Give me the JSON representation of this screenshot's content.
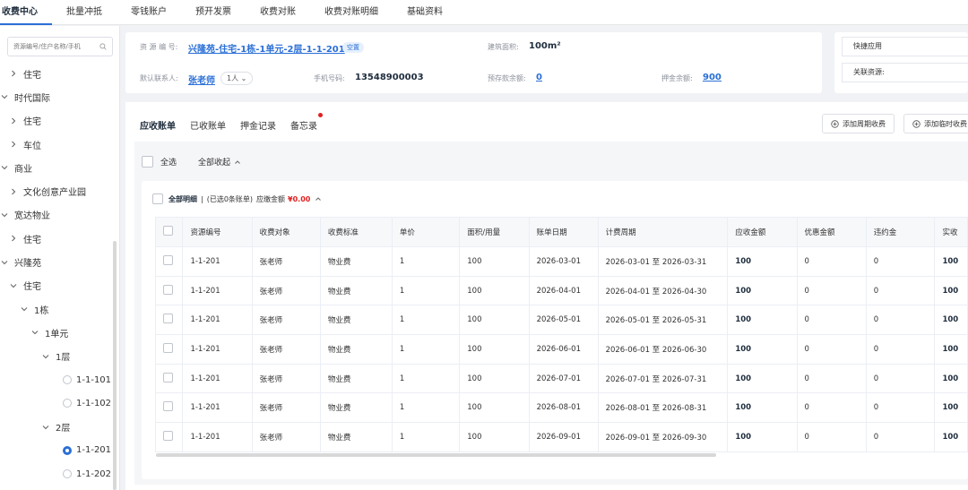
{
  "topnav": {
    "tabs": [
      "收费中心",
      "批量冲抵",
      "零钱账户",
      "预开发票",
      "收费对账",
      "收费对账明细",
      "基础资料"
    ]
  },
  "sidebar": {
    "search_placeholder": "资源编号/住户名称/手机",
    "tree": [
      {
        "label": "住宅",
        "level": 1,
        "icon": "chevron-right"
      },
      {
        "label": "时代国际",
        "level": 0,
        "icon": "chevron-down"
      },
      {
        "label": "住宅",
        "level": 1,
        "icon": "chevron-right"
      },
      {
        "label": "车位",
        "level": 1,
        "icon": "chevron-right"
      },
      {
        "label": "商业",
        "level": 0,
        "icon": "chevron-down"
      },
      {
        "label": "文化创意产业园",
        "level": 1,
        "icon": "chevron-right"
      },
      {
        "label": "宽达物业",
        "level": 0,
        "icon": "chevron-down"
      },
      {
        "label": "住宅",
        "level": 1,
        "icon": "chevron-right"
      },
      {
        "label": "兴隆苑",
        "level": 0,
        "icon": "chevron-down"
      },
      {
        "label": "住宅",
        "level": 1,
        "icon": "chevron-down"
      },
      {
        "label": "1栋",
        "level": 2,
        "icon": "chevron-down"
      },
      {
        "label": "1单元",
        "level": 3,
        "icon": "chevron-down"
      },
      {
        "label": "1层",
        "level": 4,
        "icon": "chevron-down"
      },
      {
        "label": "1-1-101",
        "level": 5,
        "icon": "radio"
      },
      {
        "label": "1-1-102",
        "level": 5,
        "icon": "radio"
      },
      {
        "label": "2层",
        "level": 4,
        "icon": "chevron-down"
      },
      {
        "label": "1-1-201",
        "level": 5,
        "icon": "radio-checked"
      },
      {
        "label": "1-1-202",
        "level": 5,
        "icon": "radio"
      }
    ]
  },
  "info": {
    "resource_label": "资 源 编 号:",
    "resource_value": "兴隆苑-住宅-1栋-1单元-2层-1-1-201",
    "status_badge": "空置",
    "area_label": "建筑面积:",
    "area_value": "100m²",
    "contact_label": "默认联系人:",
    "contact_value": "张老师",
    "contact_count": "1人",
    "phone_label": "手机号码:",
    "phone_value": "13548900003",
    "prepaid_label": "预存款余额:",
    "prepaid_value": "0",
    "deposit_label": "押金余额:",
    "deposit_value": "900"
  },
  "quick": {
    "apps_label": "快捷应用",
    "related_label": "关联资源:"
  },
  "main": {
    "subtabs": [
      "应收账单",
      "已收账单",
      "押金记录",
      "备忘录"
    ],
    "btn_periodic": "添加周期收费",
    "btn_temp": "添加临时收费",
    "select_all": "全选",
    "collapse_all": "全部收起",
    "detail_title": "全部明细",
    "detail_sep": "|",
    "detail_selected": "(已选0条账单)",
    "detail_due_label": "应缴金额",
    "detail_due_value": "¥0.00"
  },
  "table": {
    "headers": [
      "资源编号",
      "收费对象",
      "收费标准",
      "单价",
      "面积/用量",
      "账单日期",
      "计费周期",
      "应收金额",
      "优惠金额",
      "违约金",
      "实收"
    ],
    "rows": [
      [
        "1-1-201",
        "张老师",
        "物业费",
        "1",
        "100",
        "2026-03-01",
        "2026-03-01 至 2026-03-31",
        "100",
        "0",
        "0",
        "100"
      ],
      [
        "1-1-201",
        "张老师",
        "物业费",
        "1",
        "100",
        "2026-04-01",
        "2026-04-01 至 2026-04-30",
        "100",
        "0",
        "0",
        "100"
      ],
      [
        "1-1-201",
        "张老师",
        "物业费",
        "1",
        "100",
        "2026-05-01",
        "2026-05-01 至 2026-05-31",
        "100",
        "0",
        "0",
        "100"
      ],
      [
        "1-1-201",
        "张老师",
        "物业费",
        "1",
        "100",
        "2026-06-01",
        "2026-06-01 至 2026-06-30",
        "100",
        "0",
        "0",
        "100"
      ],
      [
        "1-1-201",
        "张老师",
        "物业费",
        "1",
        "100",
        "2026-07-01",
        "2026-07-01 至 2026-07-31",
        "100",
        "0",
        "0",
        "100"
      ],
      [
        "1-1-201",
        "张老师",
        "物业费",
        "1",
        "100",
        "2026-08-01",
        "2026-08-01 至 2026-08-31",
        "100",
        "0",
        "0",
        "100"
      ],
      [
        "1-1-201",
        "张老师",
        "物业费",
        "1",
        "100",
        "2026-09-01",
        "2026-09-01 至 2026-09-30",
        "100",
        "0",
        "0",
        "100"
      ]
    ]
  },
  "colors": {
    "accent": "#2b6fd6",
    "alert": "#e02020"
  }
}
